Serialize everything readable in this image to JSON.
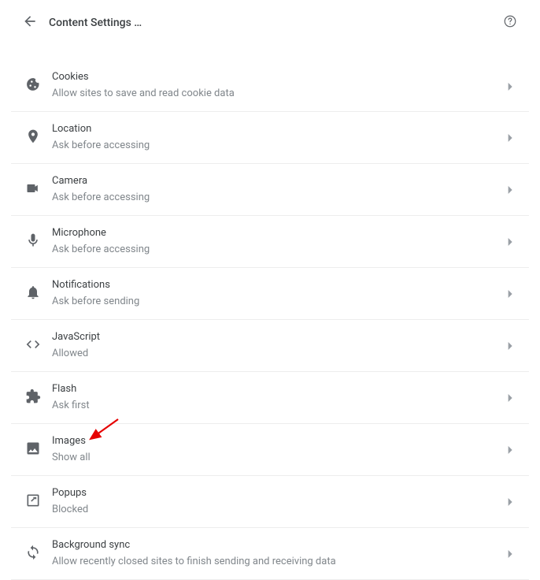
{
  "header": {
    "title": "Content Settings …"
  },
  "items": [
    {
      "key": "cookies",
      "title": "Cookies",
      "subtitle": "Allow sites to save and read cookie data"
    },
    {
      "key": "location",
      "title": "Location",
      "subtitle": "Ask before accessing"
    },
    {
      "key": "camera",
      "title": "Camera",
      "subtitle": "Ask before accessing"
    },
    {
      "key": "microphone",
      "title": "Microphone",
      "subtitle": "Ask before accessing"
    },
    {
      "key": "notifications",
      "title": "Notifications",
      "subtitle": "Ask before sending"
    },
    {
      "key": "javascript",
      "title": "JavaScript",
      "subtitle": "Allowed"
    },
    {
      "key": "flash",
      "title": "Flash",
      "subtitle": "Ask first"
    },
    {
      "key": "images",
      "title": "Images",
      "subtitle": "Show all"
    },
    {
      "key": "popups",
      "title": "Popups",
      "subtitle": "Blocked"
    },
    {
      "key": "background-sync",
      "title": "Background sync",
      "subtitle": "Allow recently closed sites to finish sending and receiving data"
    }
  ]
}
